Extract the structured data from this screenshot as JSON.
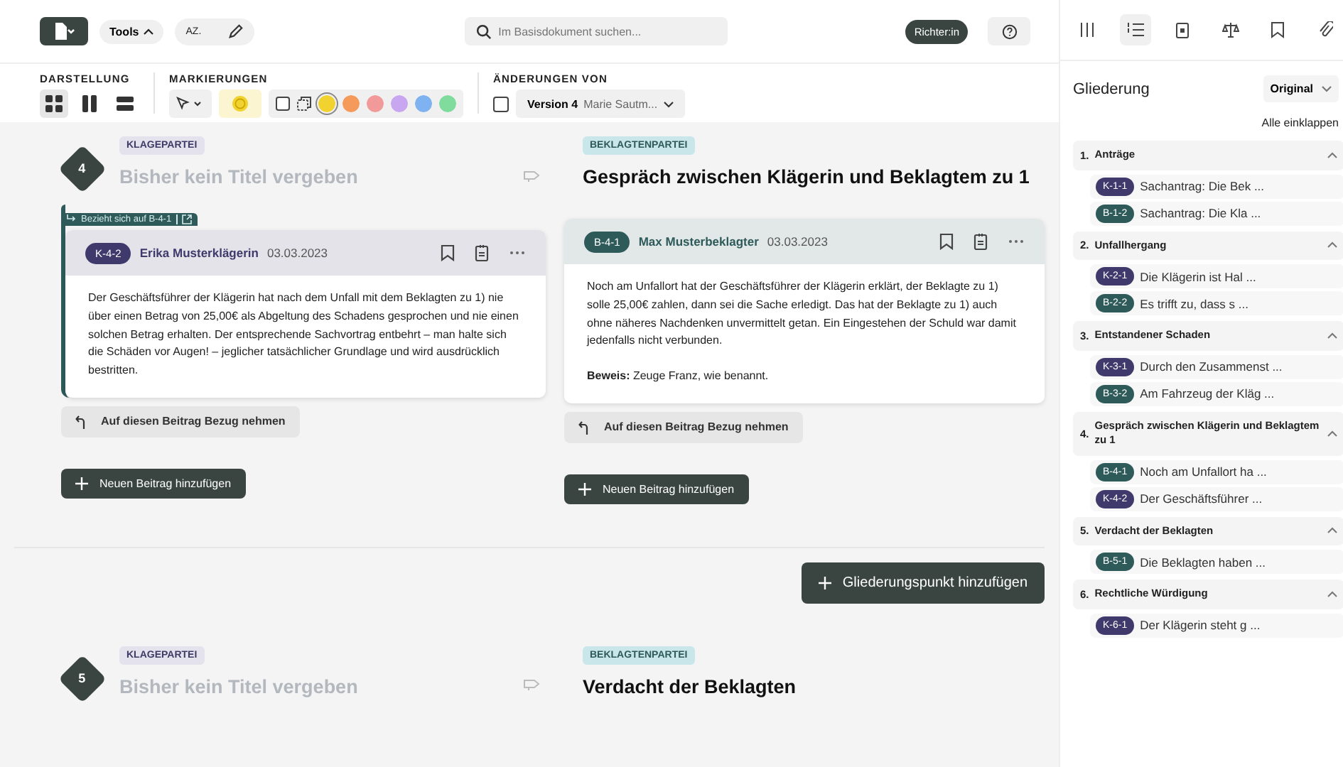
{
  "toolbar": {
    "tools_label": "Tools",
    "case_number": "AZ.",
    "search_placeholder": "Im Basisdokument suchen...",
    "role": "Richter:in"
  },
  "ribbon": {
    "view_title": "DARSTELLUNG",
    "views": [
      {
        "kind": "grid",
        "selected": true
      },
      {
        "kind": "columns",
        "selected": false
      },
      {
        "kind": "rows",
        "selected": false
      }
    ],
    "marking_title": "MARKIERUNGEN",
    "colors": [
      {
        "color": "#f2d22e",
        "selected": true
      },
      {
        "color": "#f59a5a",
        "selected": false
      },
      {
        "color": "#f29a9a",
        "selected": false
      },
      {
        "color": "#c9a6f0",
        "selected": false
      },
      {
        "color": "#7fb2f0",
        "selected": false
      },
      {
        "color": "#7fdc9c",
        "selected": false
      }
    ],
    "changes_title": "ÄNDERUNGEN VON",
    "changes_checked": false,
    "version": "Version 4",
    "author": "Marie Sautm..."
  },
  "sidebar": {
    "tabs": [
      {
        "kind": "columns",
        "selected": false
      },
      {
        "kind": "list",
        "selected": true
      },
      {
        "kind": "note",
        "selected": false
      },
      {
        "kind": "scales",
        "selected": false
      },
      {
        "kind": "bookmark",
        "selected": false
      },
      {
        "kind": "clip",
        "selected": false
      }
    ],
    "title": "Gliederung",
    "mode": "Original",
    "collapse_all": "Alle einklappen",
    "items": [
      {
        "number": "1.",
        "title": "Anträge",
        "expanded": true,
        "entries": [
          {
            "code": "K-1-1",
            "color": "#3f3a6b",
            "text": "Sachantrag: Die Bek ..."
          },
          {
            "code": "B-1-2",
            "color": "#2f5a5a",
            "text": "Sachantrag: Die Kla ..."
          }
        ]
      },
      {
        "number": "2.",
        "title": "Unfallhergang",
        "expanded": true,
        "entries": [
          {
            "code": "K-2-1",
            "color": "#3f3a6b",
            "text": "Die Klägerin ist Hal ..."
          },
          {
            "code": "B-2-2",
            "color": "#2f5a5a",
            "text": "Es trifft zu, dass s ..."
          }
        ]
      },
      {
        "number": "3.",
        "title": "Entstandener Schaden",
        "expanded": true,
        "entries": [
          {
            "code": "K-3-1",
            "color": "#3f3a6b",
            "text": "Durch den Zusammenst ..."
          },
          {
            "code": "B-3-2",
            "color": "#2f5a5a",
            "text": "Am Fahrzeug der Kläg ..."
          }
        ]
      },
      {
        "number": "4.",
        "title": "Gespräch zwischen Klägerin und Beklagtem zu 1",
        "expanded": true,
        "entries": [
          {
            "code": "B-4-1",
            "color": "#2f5a5a",
            "text": "Noch am Unfallort ha ..."
          },
          {
            "code": "K-4-2",
            "color": "#3f3a6b",
            "text": "Der Geschäftsführer ..."
          }
        ]
      },
      {
        "number": "5.",
        "title": "Verdacht der Beklagten",
        "expanded": true,
        "entries": [
          {
            "code": "B-5-1",
            "color": "#2f5a5a",
            "text": "Die Beklagten haben ..."
          }
        ]
      },
      {
        "number": "6.",
        "title": "Rechtliche Würdigung",
        "expanded": true,
        "entries": [
          {
            "code": "K-6-1",
            "color": "#3f3a6b",
            "text": "Der Klägerin steht g ..."
          }
        ]
      }
    ]
  },
  "sections": [
    {
      "number": "4",
      "left": {
        "label": "KLAGEPARTEI",
        "title": "Bisher kein Titel vergeben",
        "untitled": true
      },
      "right": {
        "label": "BEKLAGTENPARTEI",
        "title": "Gespräch zwischen Klägerin und Beklagtem zu 1",
        "untitled": false
      },
      "posts": [
        {
          "color": "#3f3a6b",
          "reference": "Bezieht sich auf B-4-1",
          "code": "K-4-2",
          "author": "Erika Musterklägerin",
          "date": "03.03.2023",
          "paragraphs": [
            "Der Geschäftsführer der Klägerin hat nach dem Unfall mit dem Beklagten zu 1) nie über einen Betrag von 25,00€ als Abgeltung des Schadens gesprochen und nie einen solchen Betrag erhalten. Der entsprechende Sachvortrag entbehrt – man halte sich die Schäden vor Augen! – jeglicher tatsächlicher Grundlage und wird ausdrücklich bestritten."
          ],
          "reply": "Auf diesen Beitrag Bezug nehmen"
        },
        {
          "color": "#2f5a5a",
          "code": "B-4-1",
          "author": "Max Musterbeklagter",
          "date": "03.03.2023",
          "paragraphs": [
            "Noch am Unfallort hat der Geschäftsführer der Klägerin erklärt, der Beklagte zu 1) solle 25,00€ zahlen, dann sei die Sache erledigt. Das hat der Beklagte zu 1) auch ohne näheres Nachdenken unvermittelt getan. Ein Eingestehen der Schuld war damit jedenfalls nicht verbunden.",
            "**Beweis:** Zeuge Franz, wie benannt."
          ],
          "reply": "Auf diesen Beitrag Bezug nehmen"
        }
      ],
      "add_buttons": [
        "Neuen Beitrag hinzufügen",
        "Neuen Beitrag hinzufügen"
      ]
    },
    {
      "number": "5",
      "left": {
        "label": "KLAGEPARTEI",
        "title": "Bisher kein Titel vergeben",
        "untitled": true
      },
      "right": {
        "label": "BEKLAGTENPARTEI",
        "title": "Verdacht der Beklagten",
        "untitled": false
      }
    }
  ],
  "add_section": "Gliederungspunkt hinzufügen"
}
